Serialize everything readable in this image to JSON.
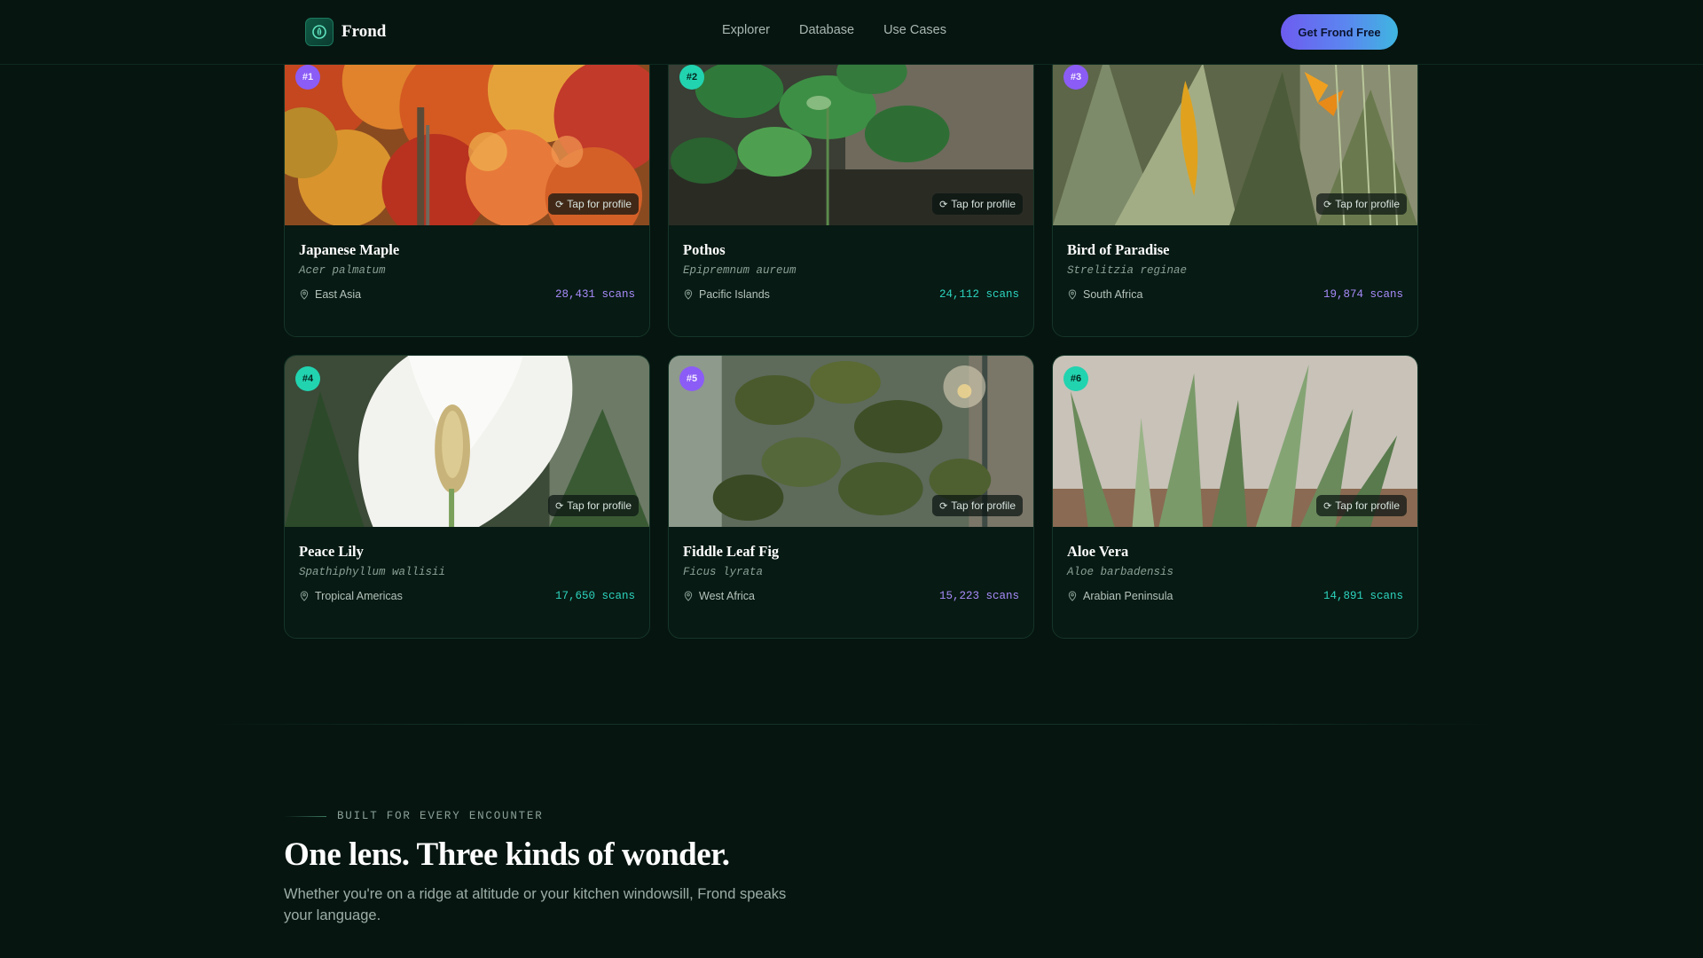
{
  "header": {
    "brand": "Frond",
    "nav": [
      "Explorer",
      "Database",
      "Use Cases"
    ],
    "cta_label": "Get Frond Free"
  },
  "cards": [
    {
      "rank": "#1",
      "name": "Japanese Maple",
      "latin": "Acer palmatum",
      "origin": "East Asia",
      "scans": "28,431 scans",
      "accent": "#8b5cf6",
      "tap": "Tap for profile"
    },
    {
      "rank": "#2",
      "name": "Pothos",
      "latin": "Epipremnum aureum",
      "origin": "Pacific Islands",
      "scans": "24,112 scans",
      "accent": "#22d3b0",
      "tap": "Tap for profile"
    },
    {
      "rank": "#3",
      "name": "Bird of Paradise",
      "latin": "Strelitzia reginae",
      "origin": "South Africa",
      "scans": "19,874 scans",
      "accent": "#8b5cf6",
      "tap": "Tap for profile"
    },
    {
      "rank": "#4",
      "name": "Peace Lily",
      "latin": "Spathiphyllum wallisii",
      "origin": "Tropical Americas",
      "scans": "17,650 scans",
      "accent": "#22d3b0",
      "tap": "Tap for profile"
    },
    {
      "rank": "#5",
      "name": "Fiddle Leaf Fig",
      "latin": "Ficus lyrata",
      "origin": "West Africa",
      "scans": "15,223 scans",
      "accent": "#8b5cf6",
      "tap": "Tap for profile"
    },
    {
      "rank": "#6",
      "name": "Aloe Vera",
      "latin": "Aloe barbadensis",
      "origin": "Arabian Peninsula",
      "scans": "14,891 scans",
      "accent": "#22d3b0",
      "tap": "Tap for profile"
    }
  ],
  "section": {
    "eyebrow": "BUILT FOR EVERY ENCOUNTER",
    "title": "One lens. Three kinds of wonder.",
    "subtitle": "Whether you're on a ridge at altitude or your kitchen windowsill, Frond speaks your language."
  },
  "colors": {
    "background": "#061510",
    "purple_accent": "#8b5cf6",
    "teal_accent": "#22d3b0",
    "cta_gradient_start": "#6d5cf0",
    "cta_gradient_end": "#3fb6e0"
  },
  "icons": [
    "leaf-logo-icon",
    "refresh-icon",
    "location-pin-icon"
  ]
}
